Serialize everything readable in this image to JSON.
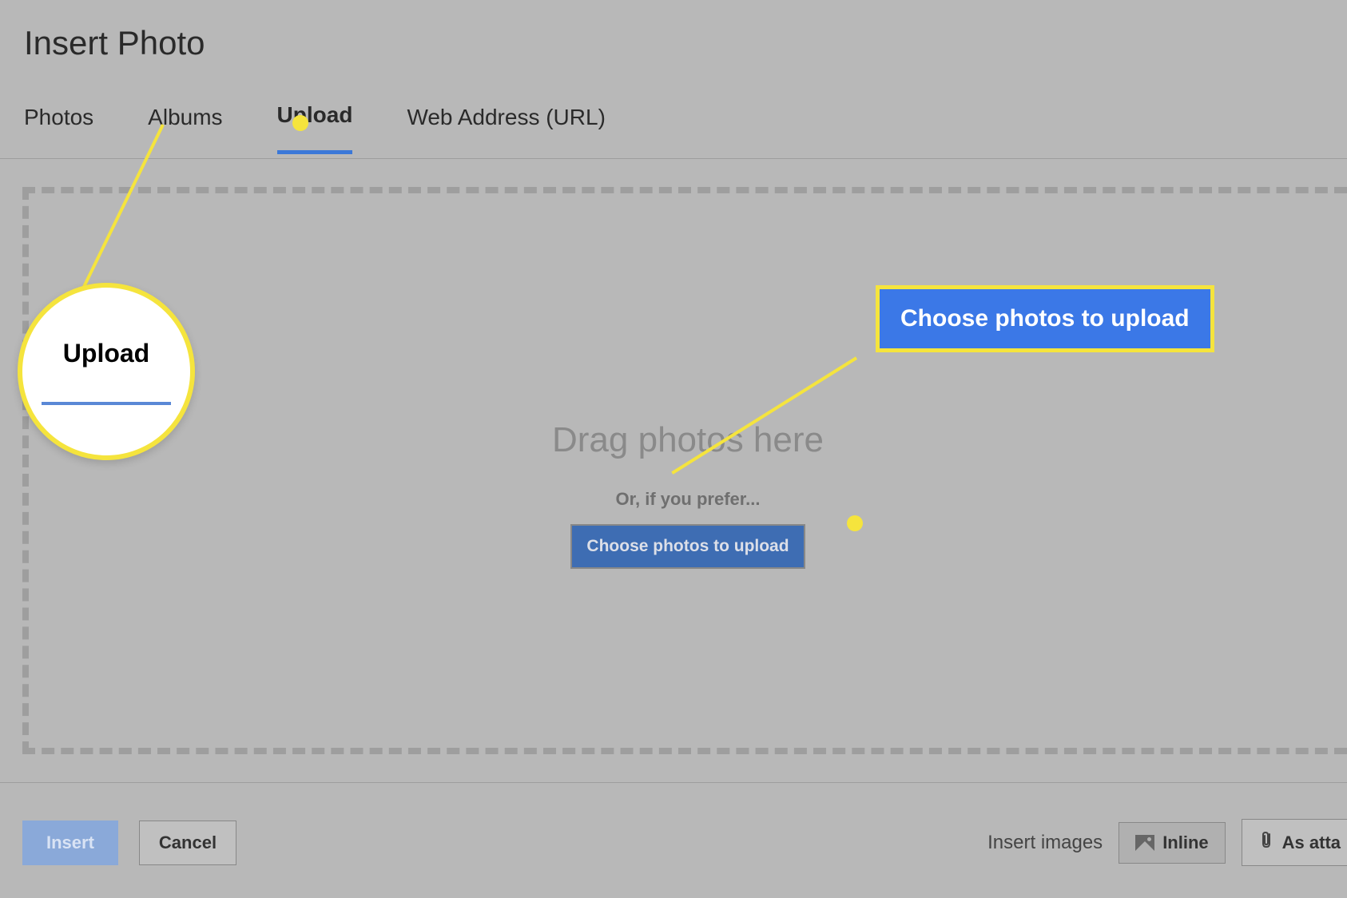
{
  "title": "Insert Photo",
  "tabs": {
    "photos": "Photos",
    "albums": "Albums",
    "upload": "Upload",
    "url": "Web Address (URL)"
  },
  "dropzone": {
    "drag_text": "Drag photos here",
    "prefer_text": "Or, if you prefer...",
    "choose_button": "Choose photos to upload"
  },
  "footer": {
    "insert": "Insert",
    "cancel": "Cancel",
    "insert_images_label": "Insert images",
    "inline": "Inline",
    "as_atta": "As atta"
  },
  "callouts": {
    "upload_zoom": "Upload",
    "choose_big": "Choose photos to upload"
  }
}
